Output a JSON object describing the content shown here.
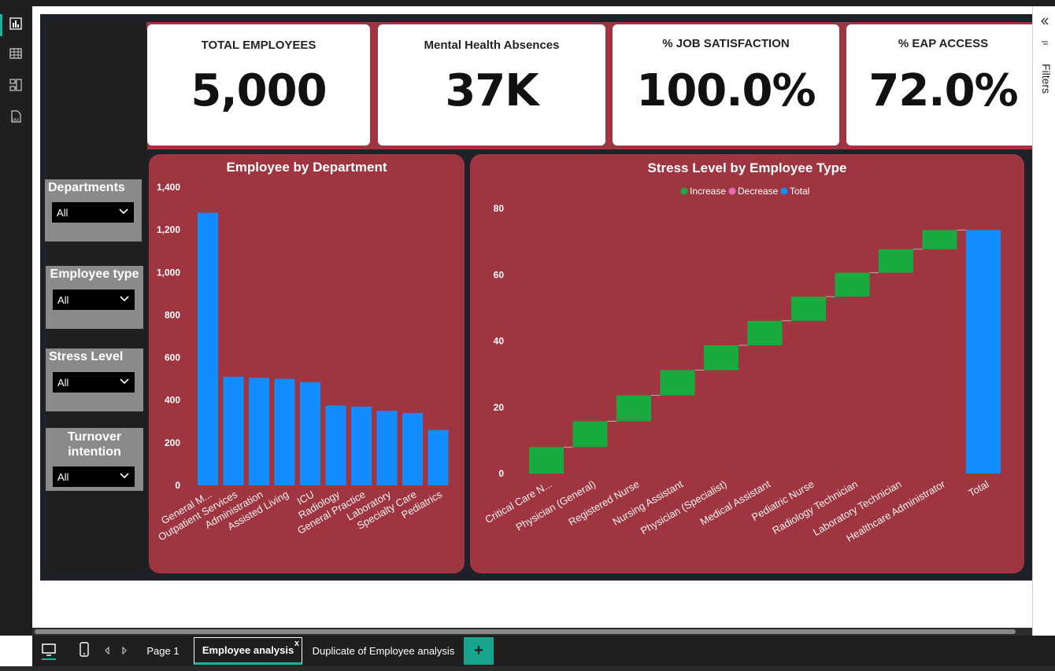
{
  "left_rail": {
    "icons": [
      "report-view-icon",
      "table-view-icon",
      "model-view-icon",
      "dax-query-icon"
    ]
  },
  "cards": [
    {
      "title": "TOTAL EMPLOYEES",
      "value": "5,000"
    },
    {
      "title": "Mental Health Absences",
      "value": "37K"
    },
    {
      "title": "% JOB SATISFACTION",
      "value": "100.0%"
    },
    {
      "title": "% EAP ACCESS",
      "value": "72.0%"
    }
  ],
  "slicers": [
    {
      "label": "Departments",
      "value": "All"
    },
    {
      "label": "Employee type",
      "value": "All"
    },
    {
      "label": "Stress Level",
      "value": "All"
    },
    {
      "label": "Turnover intention",
      "value": "All"
    }
  ],
  "filters_pane": {
    "label": "Filters"
  },
  "tabs": {
    "page1": "Page 1",
    "active": "Employee analysis",
    "duplicate": "Duplicate of Employee analysis",
    "close": "x",
    "add": "+"
  },
  "colors": {
    "maroon": "#9e3540",
    "bar_blue": "#118dff",
    "increase": "#1aab40",
    "decrease": "#e66cb8",
    "total": "#118dff",
    "accent": "#18b39a"
  },
  "chart_data": [
    {
      "type": "bar",
      "title": "Employee by Department",
      "categories": [
        "General M...",
        "Outpatient Services",
        "Administration",
        "Assisted Living",
        "ICU",
        "Radiology",
        "General Practice",
        "Laboratory",
        "Specialty Care",
        "Pediatrics"
      ],
      "values": [
        1280,
        510,
        505,
        500,
        485,
        375,
        370,
        350,
        340,
        260
      ],
      "ylim": [
        0,
        1400
      ],
      "yticks": [
        0,
        200,
        400,
        600,
        800,
        1000,
        1200,
        1400
      ],
      "ytick_labels": [
        "0",
        "200",
        "400",
        "600",
        "800",
        "1,000",
        "1,200",
        "1,400"
      ],
      "xlabel": "",
      "ylabel": ""
    },
    {
      "type": "waterfall",
      "title": "Stress Level by Employee Type",
      "legend": [
        "Increase",
        "Decrease",
        "Total"
      ],
      "categories": [
        "Critical Care N...",
        "Physician (General)",
        "Registered Nurse",
        "Nursing Assistant",
        "Physician (Specialist)",
        "Medical Assistant",
        "Pediatric Nurse",
        "Radiology Technician",
        "Laboratory Technician",
        "Healthcare Administrator",
        "Total"
      ],
      "values": [
        8,
        7.8,
        7.8,
        7.6,
        7.5,
        7.4,
        7.3,
        7.2,
        7.1,
        5.8,
        73.5
      ],
      "ylim": [
        0,
        80
      ],
      "yticks": [
        0,
        20,
        40,
        60,
        80
      ],
      "xlabel": "",
      "ylabel": ""
    }
  ]
}
